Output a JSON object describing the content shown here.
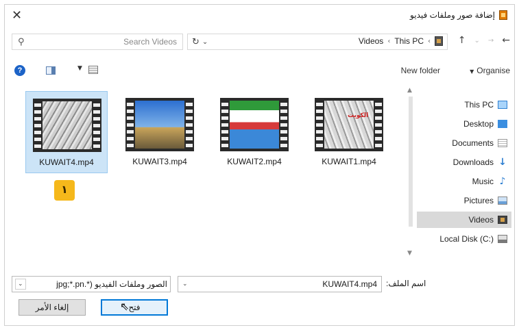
{
  "window": {
    "title": "إضافة صور وملفات فيديو",
    "close_glyph": "✕"
  },
  "nav": {
    "search_placeholder": "Search Videos",
    "breadcrumbs": [
      "This PC",
      "Videos"
    ],
    "back_glyph": "←",
    "forward_glyph": "→",
    "up_glyph": "↑"
  },
  "toolbar": {
    "organise_label": "Organise",
    "new_folder_label": "New folder",
    "help_glyph": "?"
  },
  "files": [
    {
      "name": "KUWAIT4.mp4",
      "selected": true
    },
    {
      "name": "KUWAIT3.mp4",
      "selected": false
    },
    {
      "name": "KUWAIT2.mp4",
      "selected": false
    },
    {
      "name": "KUWAIT1.mp4",
      "selected": false
    }
  ],
  "step_badge": "١",
  "thumbnail_map_text": "الكويت",
  "sidebar": {
    "items": [
      {
        "label": "This PC",
        "icon": "computer-icon"
      },
      {
        "label": "Desktop",
        "icon": "desktop-icon"
      },
      {
        "label": "Documents",
        "icon": "documents-icon"
      },
      {
        "label": "Downloads",
        "icon": "downloads-icon"
      },
      {
        "label": "Music",
        "icon": "music-icon"
      },
      {
        "label": "Pictures",
        "icon": "pictures-icon"
      },
      {
        "label": "Videos",
        "icon": "videos-icon",
        "active": true
      },
      {
        "label": "Local Disk (C:)",
        "icon": "disk-icon"
      }
    ]
  },
  "bottom": {
    "file_name_label": "اسم الملف:",
    "file_name_value": "KUWAIT4.mp4",
    "filter_value": "الصور وملفات الفيديو (*.jpg;*.pn",
    "open_label": "فتح",
    "cancel_label": "إلغاء الأمر"
  },
  "colors": {
    "selection": "#cce4f7",
    "accent": "#0078d7",
    "badge": "#f5b81b"
  }
}
